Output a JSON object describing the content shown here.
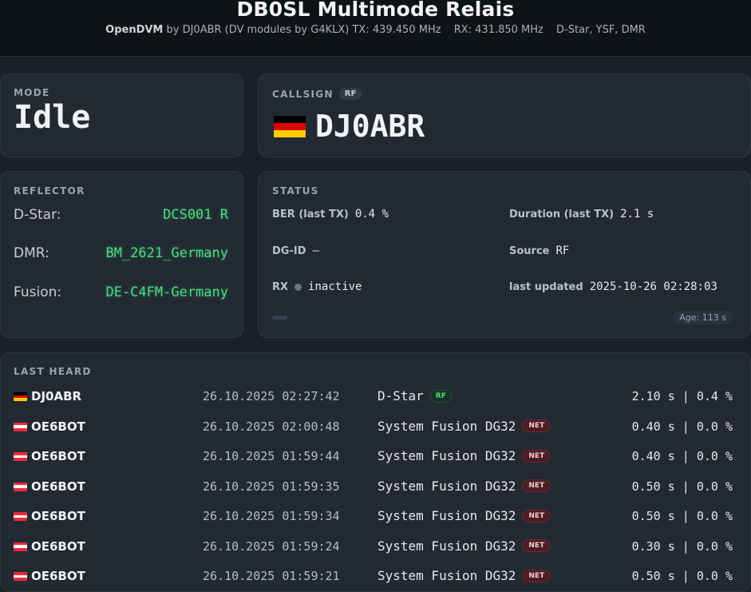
{
  "header": {
    "title": "DB0SL Multimode Relais",
    "software": "OpenDVM",
    "byline": "by DJ0ABR (DV modules by G4KLX)",
    "tx": "TX: 439.450 MHz",
    "rx": "RX: 431.850 MHz",
    "modes": "D-Star, YSF, DMR"
  },
  "mode": {
    "label": "MODE",
    "value": "Idle"
  },
  "callsign": {
    "label": "CALLSIGN",
    "source_badge": "RF",
    "value": "DJ0ABR",
    "flag": "flag-germany"
  },
  "reflector": {
    "label": "REFLECTOR",
    "items": [
      {
        "key": "D-Star:",
        "value": "DCS001 R"
      },
      {
        "key": "DMR:",
        "value": "BM_2621_Germany"
      },
      {
        "key": "Fusion:",
        "value": "DE-C4FM-Germany"
      }
    ]
  },
  "status": {
    "label": "STATUS",
    "ber_label": "BER (last TX)",
    "ber_value": "0.4 %",
    "duration_label": "Duration (last TX)",
    "duration_value": "2.1 s",
    "dgid_label": "DG-ID",
    "dgid_value": "–",
    "source_label": "Source",
    "source_value": "RF",
    "rx_label": "RX",
    "rx_value": "inactive",
    "updated_label": "last updated",
    "updated_value": "2025-10-26 02:28:03",
    "age": "Age: 113 s",
    "colors": {
      "inactive_dot": "#6b7280"
    }
  },
  "last_heard": {
    "label": "LAST HEARD",
    "rows": [
      {
        "flag": "flag-germany",
        "call": "DJ0ABR",
        "time": "26.10.2025 02:27:42",
        "mode": "D-Star",
        "badge": "RF",
        "stats": "2.10 s | 0.4 %"
      },
      {
        "flag": "flag-austria",
        "call": "OE6BOT",
        "time": "26.10.2025 02:00:48",
        "mode": "System Fusion DG32",
        "badge": "NET",
        "stats": "0.40 s | 0.0 %"
      },
      {
        "flag": "flag-austria",
        "call": "OE6BOT",
        "time": "26.10.2025 01:59:44",
        "mode": "System Fusion DG32",
        "badge": "NET",
        "stats": "0.40 s | 0.0 %"
      },
      {
        "flag": "flag-austria",
        "call": "OE6BOT",
        "time": "26.10.2025 01:59:35",
        "mode": "System Fusion DG32",
        "badge": "NET",
        "stats": "0.50 s | 0.0 %"
      },
      {
        "flag": "flag-austria",
        "call": "OE6BOT",
        "time": "26.10.2025 01:59:34",
        "mode": "System Fusion DG32",
        "badge": "NET",
        "stats": "0.50 s | 0.0 %"
      },
      {
        "flag": "flag-austria",
        "call": "OE6BOT",
        "time": "26.10.2025 01:59:24",
        "mode": "System Fusion DG32",
        "badge": "NET",
        "stats": "0.30 s | 0.0 %"
      },
      {
        "flag": "flag-austria",
        "call": "OE6BOT",
        "time": "26.10.2025 01:59:21",
        "mode": "System Fusion DG32",
        "badge": "NET",
        "stats": "0.50 s | 0.0 %"
      }
    ]
  }
}
